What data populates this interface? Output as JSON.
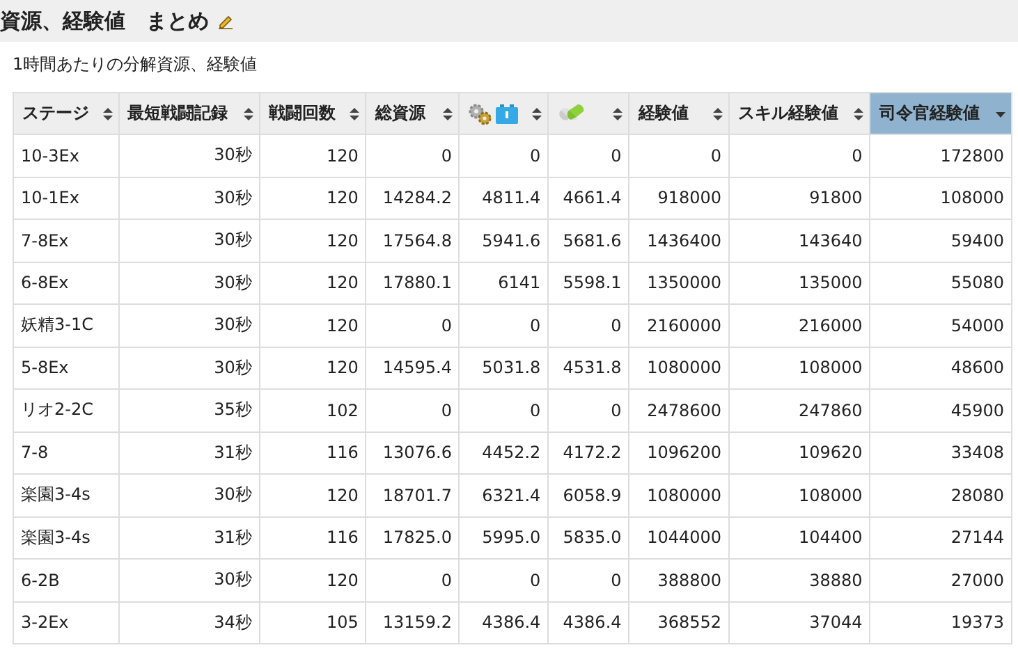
{
  "title": "資源、経験値　まとめ",
  "subtitle": "1時間あたりの分解資源、経験値",
  "table": {
    "columns": [
      {
        "kind": "text",
        "label": "ステージ",
        "selected": false
      },
      {
        "kind": "text",
        "label": "最短戦闘記録",
        "selected": false
      },
      {
        "kind": "text",
        "label": "戦闘回数",
        "selected": false
      },
      {
        "kind": "text",
        "label": "総資源",
        "selected": false
      },
      {
        "kind": "parts-icon",
        "selected": false
      },
      {
        "kind": "capsule-icon",
        "selected": false
      },
      {
        "kind": "text",
        "label": "経験値",
        "selected": false
      },
      {
        "kind": "text",
        "label": "スキル経験値",
        "selected": false
      },
      {
        "kind": "text",
        "label": "司令官経験値",
        "selected": true
      }
    ],
    "rows": [
      [
        "10-3Ex",
        "30秒",
        "120",
        "0",
        "0",
        "0",
        "0",
        "0",
        "172800"
      ],
      [
        "10-1Ex",
        "30秒",
        "120",
        "14284.2",
        "4811.4",
        "4661.4",
        "918000",
        "91800",
        "108000"
      ],
      [
        "7-8Ex",
        "30秒",
        "120",
        "17564.8",
        "5941.6",
        "5681.6",
        "1436400",
        "143640",
        "59400"
      ],
      [
        "6-8Ex",
        "30秒",
        "120",
        "17880.1",
        "6141",
        "5598.1",
        "1350000",
        "135000",
        "55080"
      ],
      [
        "妖精3-1C",
        "30秒",
        "120",
        "0",
        "0",
        "0",
        "2160000",
        "216000",
        "54000"
      ],
      [
        "5-8Ex",
        "30秒",
        "120",
        "14595.4",
        "5031.8",
        "4531.8",
        "1080000",
        "108000",
        "48600"
      ],
      [
        "リオ2-2C",
        "35秒",
        "102",
        "0",
        "0",
        "0",
        "2478600",
        "247860",
        "45900"
      ],
      [
        "7-8",
        "31秒",
        "116",
        "13076.6",
        "4452.2",
        "4172.2",
        "1096200",
        "109620",
        "33408"
      ],
      [
        "楽園3-4s",
        "30秒",
        "120",
        "18701.7",
        "6321.4",
        "6058.9",
        "1080000",
        "108000",
        "28080"
      ],
      [
        "楽園3-4s",
        "31秒",
        "116",
        "17825.0",
        "5995.0",
        "5835.0",
        "1044000",
        "104400",
        "27144"
      ],
      [
        "6-2B",
        "30秒",
        "120",
        "0",
        "0",
        "0",
        "388800",
        "38880",
        "27000"
      ],
      [
        "3-2Ex",
        "34秒",
        "105",
        "13159.2",
        "4386.4",
        "4386.4",
        "368552",
        "37044",
        "19373"
      ]
    ]
  }
}
